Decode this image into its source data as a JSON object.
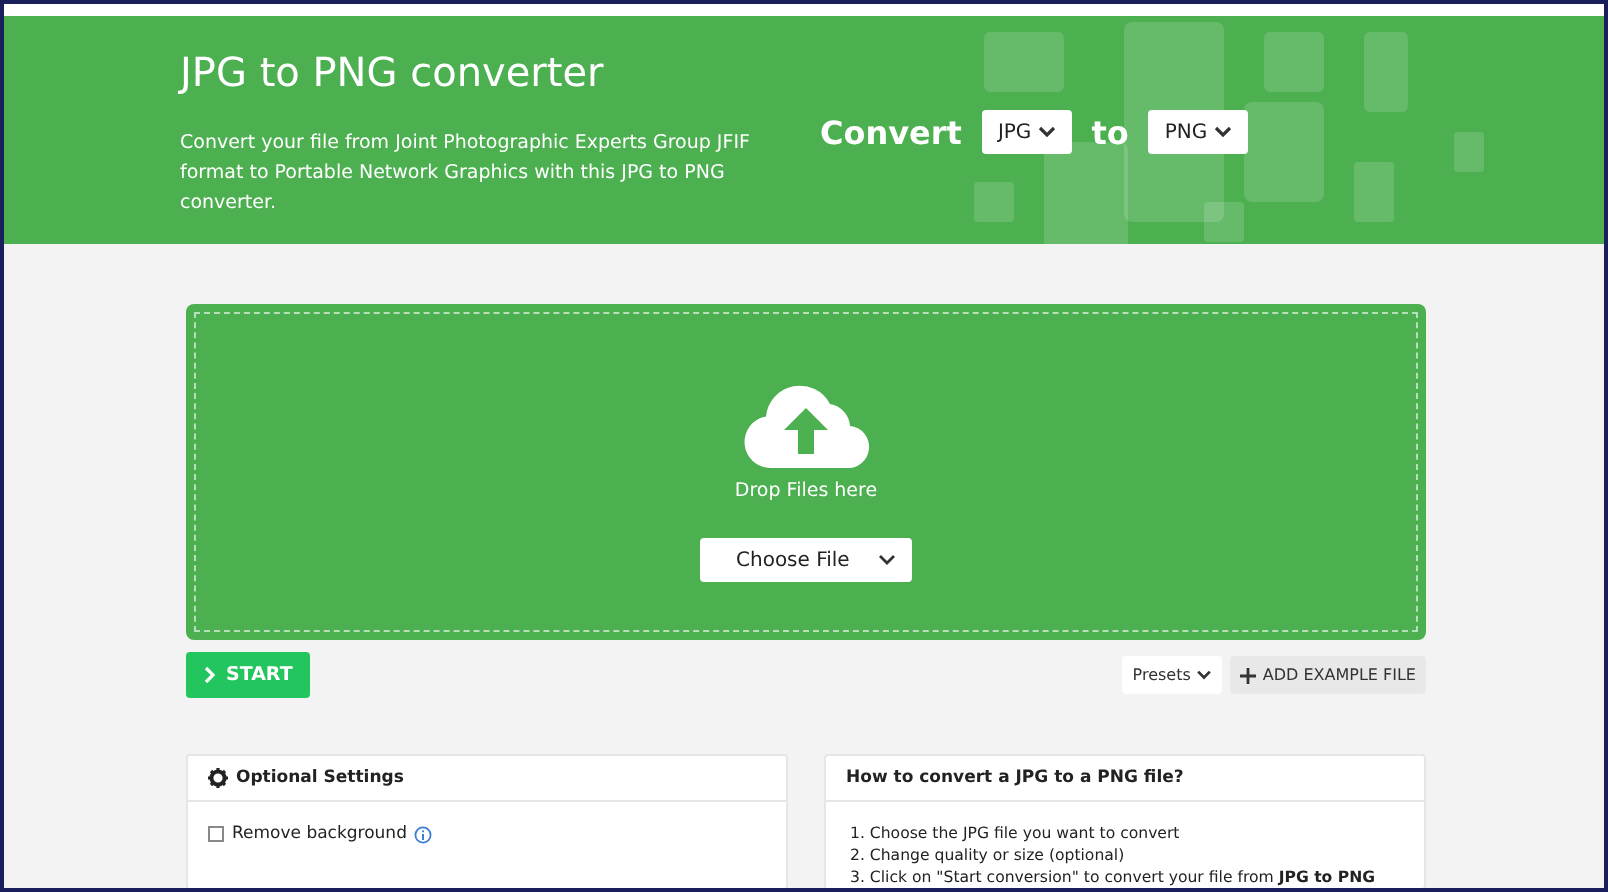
{
  "header": {
    "title": "JPG to PNG converter",
    "description": "Convert your file from Joint Photographic Experts Group JFIF format to Portable Network Graphics with this JPG to PNG converter.",
    "convert_label": "Convert",
    "from_format": "JPG",
    "to_label": "to",
    "to_format": "PNG"
  },
  "dropzone": {
    "text": "Drop Files here",
    "choose_button": "Choose File"
  },
  "actions": {
    "start": "START",
    "presets": "Presets",
    "add_example": "ADD EXAMPLE FILE"
  },
  "optional_settings": {
    "title": "Optional Settings",
    "options": [
      {
        "label": "Remove background",
        "checked": false
      }
    ]
  },
  "howto": {
    "title": "How to convert a JPG to a PNG file?",
    "steps": [
      "1. Choose the JPG file you want to convert",
      "2. Change quality or size (optional)",
      "3. Click on \"Start conversion\" to convert your file from **JPG to PNG**"
    ]
  }
}
